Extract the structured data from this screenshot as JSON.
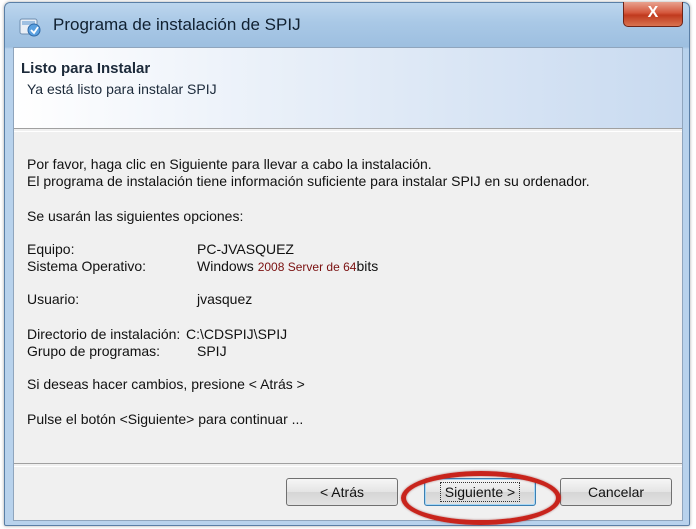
{
  "window": {
    "title": "Programa de instalación de SPIJ",
    "close_label": "X"
  },
  "header": {
    "title": "Listo para Instalar",
    "subtitle": "Ya está listo para instalar SPIJ"
  },
  "body": {
    "intro_line1": "Por favor, haga clic en Siguiente para llevar a cabo la instalación.",
    "intro_line2": "El programa de instalación tiene información suficiente para instalar SPIJ en su ordenador.",
    "options_heading": "Se usarán las siguientes opciones:",
    "equipo_label": "Equipo:",
    "equipo_value": "PC-JVASQUEZ",
    "so_label": "Sistema Operativo:",
    "so_value_prefix": "Windows",
    "so_value_mid": "2008 Server de 64",
    "so_value_suffix": "bits",
    "usuario_label": "Usuario:",
    "usuario_value": "jvasquez",
    "dir_label": "Directorio de instalación:",
    "dir_value": "C:\\CDSPIJ\\SPIJ",
    "grupo_label": "Grupo de programas:",
    "grupo_value": "SPIJ",
    "changes_text": "Si deseas hacer cambios, presione < Atrás >",
    "continue_text": "Pulse el botón <Siguiente> para continuar ..."
  },
  "buttons": {
    "back": "< Atrás",
    "next": "Siguiente >",
    "cancel": "Cancelar"
  },
  "colors": {
    "highlight": "#c8241c",
    "close_button": "#c74a2e"
  },
  "icons": {
    "app": "installer-icon",
    "close": "close-icon"
  }
}
